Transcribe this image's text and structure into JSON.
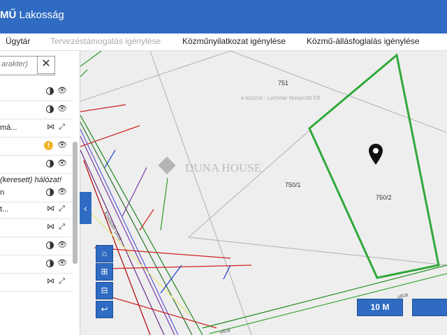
{
  "app": {
    "brand_bold": "MŰ",
    "brand_rest": " Lakosság"
  },
  "tabs": [
    {
      "label": "Ügytár"
    },
    {
      "label": "Tervezéstámogatás igénylése"
    },
    {
      "label": "Közműnyilatkozat igénylése"
    },
    {
      "label": "Közmű-állásfoglalás igénylése"
    }
  ],
  "search": {
    "placeholder": "arakter)",
    "clear_label": "✕"
  },
  "layers": [
    {
      "label": ""
    },
    {
      "label": ""
    },
    {
      "label": "má..."
    },
    {
      "label": ""
    },
    {
      "label": ""
    },
    {
      "label": "(keresett) hálózat!"
    },
    {
      "label": "n"
    },
    {
      "label": "t..."
    },
    {
      "label": ""
    },
    {
      "label": ""
    },
    {
      "label": ""
    },
    {
      "label": ""
    }
  ],
  "map": {
    "parcel_labels": [
      "751",
      "750/1",
      "750/2"
    ],
    "watermark": "e-közmű - Lechner Nonprofit Kft.",
    "logo_text": "DUNA HOUSE",
    "street_1": "Kossuth utca",
    "street_2": "utca",
    "street_3": "utca",
    "scale": "10 M",
    "collapse_icon": "‹"
  },
  "map_controls": [
    {
      "icon": "home-icon",
      "glyph": "⌂"
    },
    {
      "icon": "zoom-in-icon",
      "glyph": "⊞"
    },
    {
      "icon": "zoom-out-icon",
      "glyph": "⊟"
    },
    {
      "icon": "back-icon",
      "glyph": "↩"
    }
  ],
  "colors": {
    "primary": "#2f6bc2",
    "parcel_highlight": "#2fa83a",
    "map_bg": "#eeeeee"
  }
}
